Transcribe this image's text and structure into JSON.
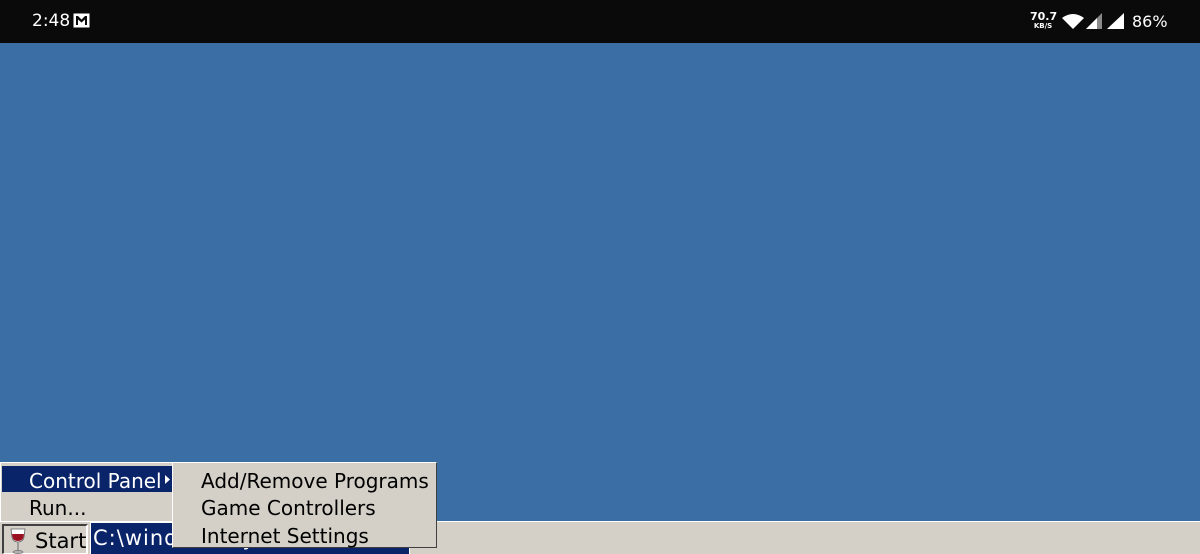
{
  "status_bar": {
    "time": "2:48",
    "net_speed_value": "70.7",
    "net_speed_unit": "KB/S",
    "battery": "86%",
    "icons": [
      "gmail-icon",
      "wifi-icon",
      "signal-icon",
      "signal-icon",
      "battery-icon"
    ]
  },
  "desktop": {
    "background_color": "#3a6ea5"
  },
  "start_menu": {
    "items": [
      {
        "label": "Control Panel",
        "selected": true,
        "has_submenu": true
      },
      {
        "label": "Run...",
        "selected": false,
        "has_submenu": false
      }
    ]
  },
  "control_panel_submenu": {
    "items": [
      {
        "label": "Add/Remove Programs"
      },
      {
        "label": "Game Controllers"
      },
      {
        "label": "Internet Settings"
      }
    ]
  },
  "taskbar": {
    "start_label": "Start",
    "start_icon": "wine-glass-icon",
    "task_label": "C:\\windows\\system32"
  },
  "colors": {
    "accent": "#0a246a",
    "face": "#d4d0c8",
    "status_bar": "#0a0a0a"
  }
}
